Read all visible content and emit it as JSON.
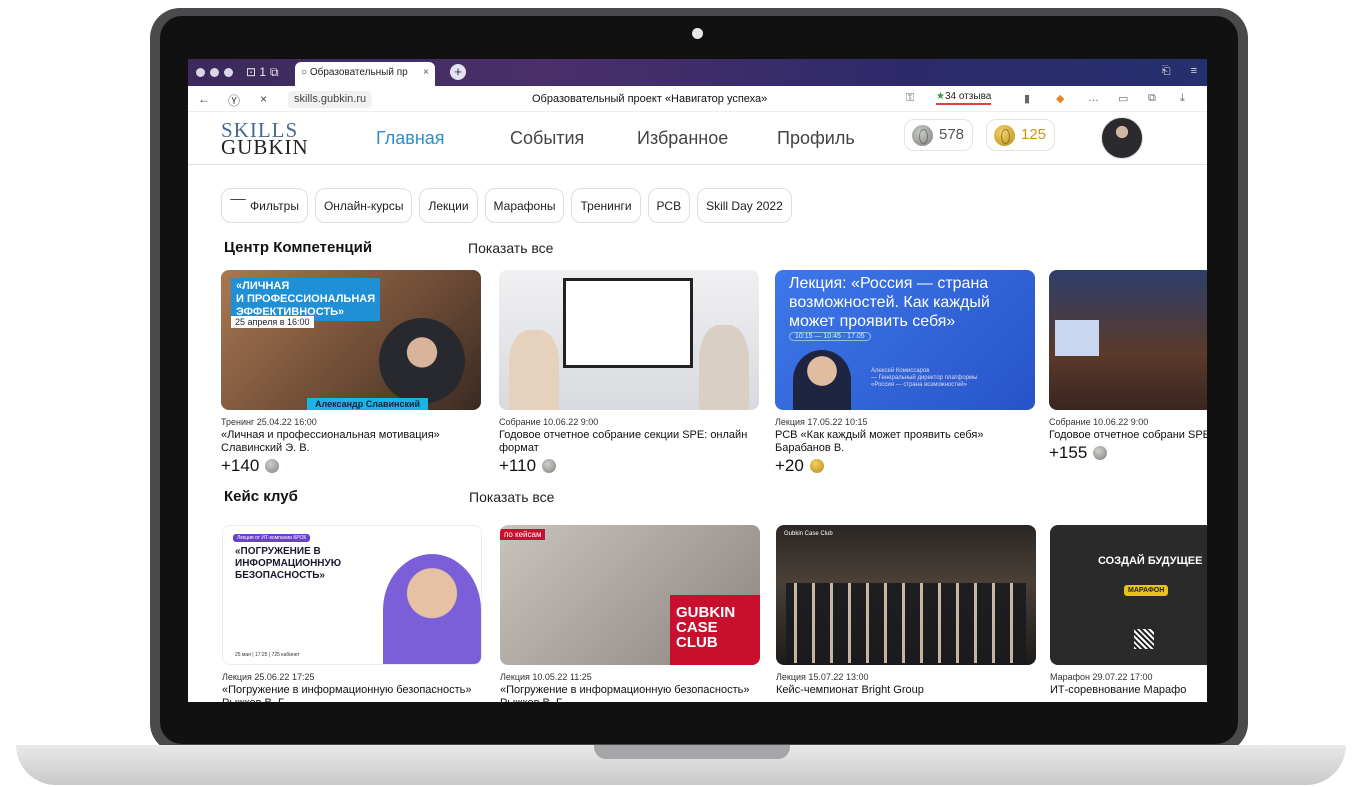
{
  "browser": {
    "tab_title": "Образовательный пр",
    "url": "skills.gubkin.ru",
    "page_title": "Образовательный проект «Навигатор успеха»",
    "reviews": "34 отзыва",
    "tab_count": "1"
  },
  "site": {
    "logo_line1": "SKILLS",
    "logo_line2": "GUBKIN",
    "nav": [
      "Главная",
      "События",
      "Избранное",
      "Профиль"
    ],
    "silver_coins": "578",
    "gold_coins": "125"
  },
  "filters": [
    "Фильтры",
    "Онлайн-курсы",
    "Лекции",
    "Марафоны",
    "Тренинги",
    "РСВ",
    "Skill Day 2022"
  ],
  "sections": [
    {
      "title": "Центр Компетенций",
      "show_all": "Показать все",
      "cards": [
        {
          "meta": "Тренинг 25.04.22 16:00",
          "title": "«Личная и профессиональная мотивация» Славинский Э. В.",
          "points": "+140",
          "coin": "silver",
          "thumb_text": [
            "«ЛИЧНАЯ",
            "И ПРОФЕССИОНАЛЬНАЯ",
            "ЭФФЕКТИВНОСТЬ»",
            "25 апреля в 16:00",
            "Александр Славинский"
          ]
        },
        {
          "meta": "Собрание 10.06.22 9:00",
          "title": "Годовое отчетное собрание секции SPE: онлайн формат",
          "points": "+110",
          "coin": "silver"
        },
        {
          "meta": "Лекция 17.05.22 10:15",
          "title": "РСВ «Как каждый может проявить себя» Барабанов В.",
          "points": "+20",
          "coin": "gold",
          "thumb_text": [
            "Лекция: «Россия — страна возможностей. Как каждый может проявить себя»",
            "10:15 — 10:45",
            "17.05",
            "Алексей Комиссаров",
            "— Генеральный директор платформы «Россия — страна возможностей»"
          ]
        },
        {
          "meta": "Собрание 10.06.22 9:00",
          "title": "Годовое отчетное собрани SPE: онлайн формат",
          "points": "+155",
          "coin": "silver"
        }
      ]
    },
    {
      "title": "Кейс клуб",
      "show_all": "Показать все",
      "cards": [
        {
          "meta": "Лекция 25.06.22 17:25",
          "title": "«Погружение в информационную безопасность» Рыжков В. Г.",
          "thumb_text": [
            "Лекция от ИТ-компании КРОК",
            "«ПОГРУЖЕНИЕ В ИНФОРМАЦИОННУЮ БЕЗОПАСНОСТЬ»",
            "25 мая | 17:25 | 725 кабинет"
          ]
        },
        {
          "meta": "Лекция 10.05.22 11:25",
          "title": "«Погружение в информационную безопасность» Рыжков В. Г.",
          "thumb_text": [
            "по кейсам",
            "GUBKIN CASE CLUB"
          ]
        },
        {
          "meta": "Лекция 15.07.22 13:00",
          "title": "Кейс-чемпионат Bright Group",
          "thumb_text": [
            "Gubkin Case Club"
          ]
        },
        {
          "meta": "Марафон 29.07.22 17:00",
          "title": "ИТ-соревнование Марафо",
          "thumb_text": [
            "СОЗДАЙ БУДУЩЕЕ",
            "МАРАФОН"
          ]
        }
      ]
    }
  ]
}
